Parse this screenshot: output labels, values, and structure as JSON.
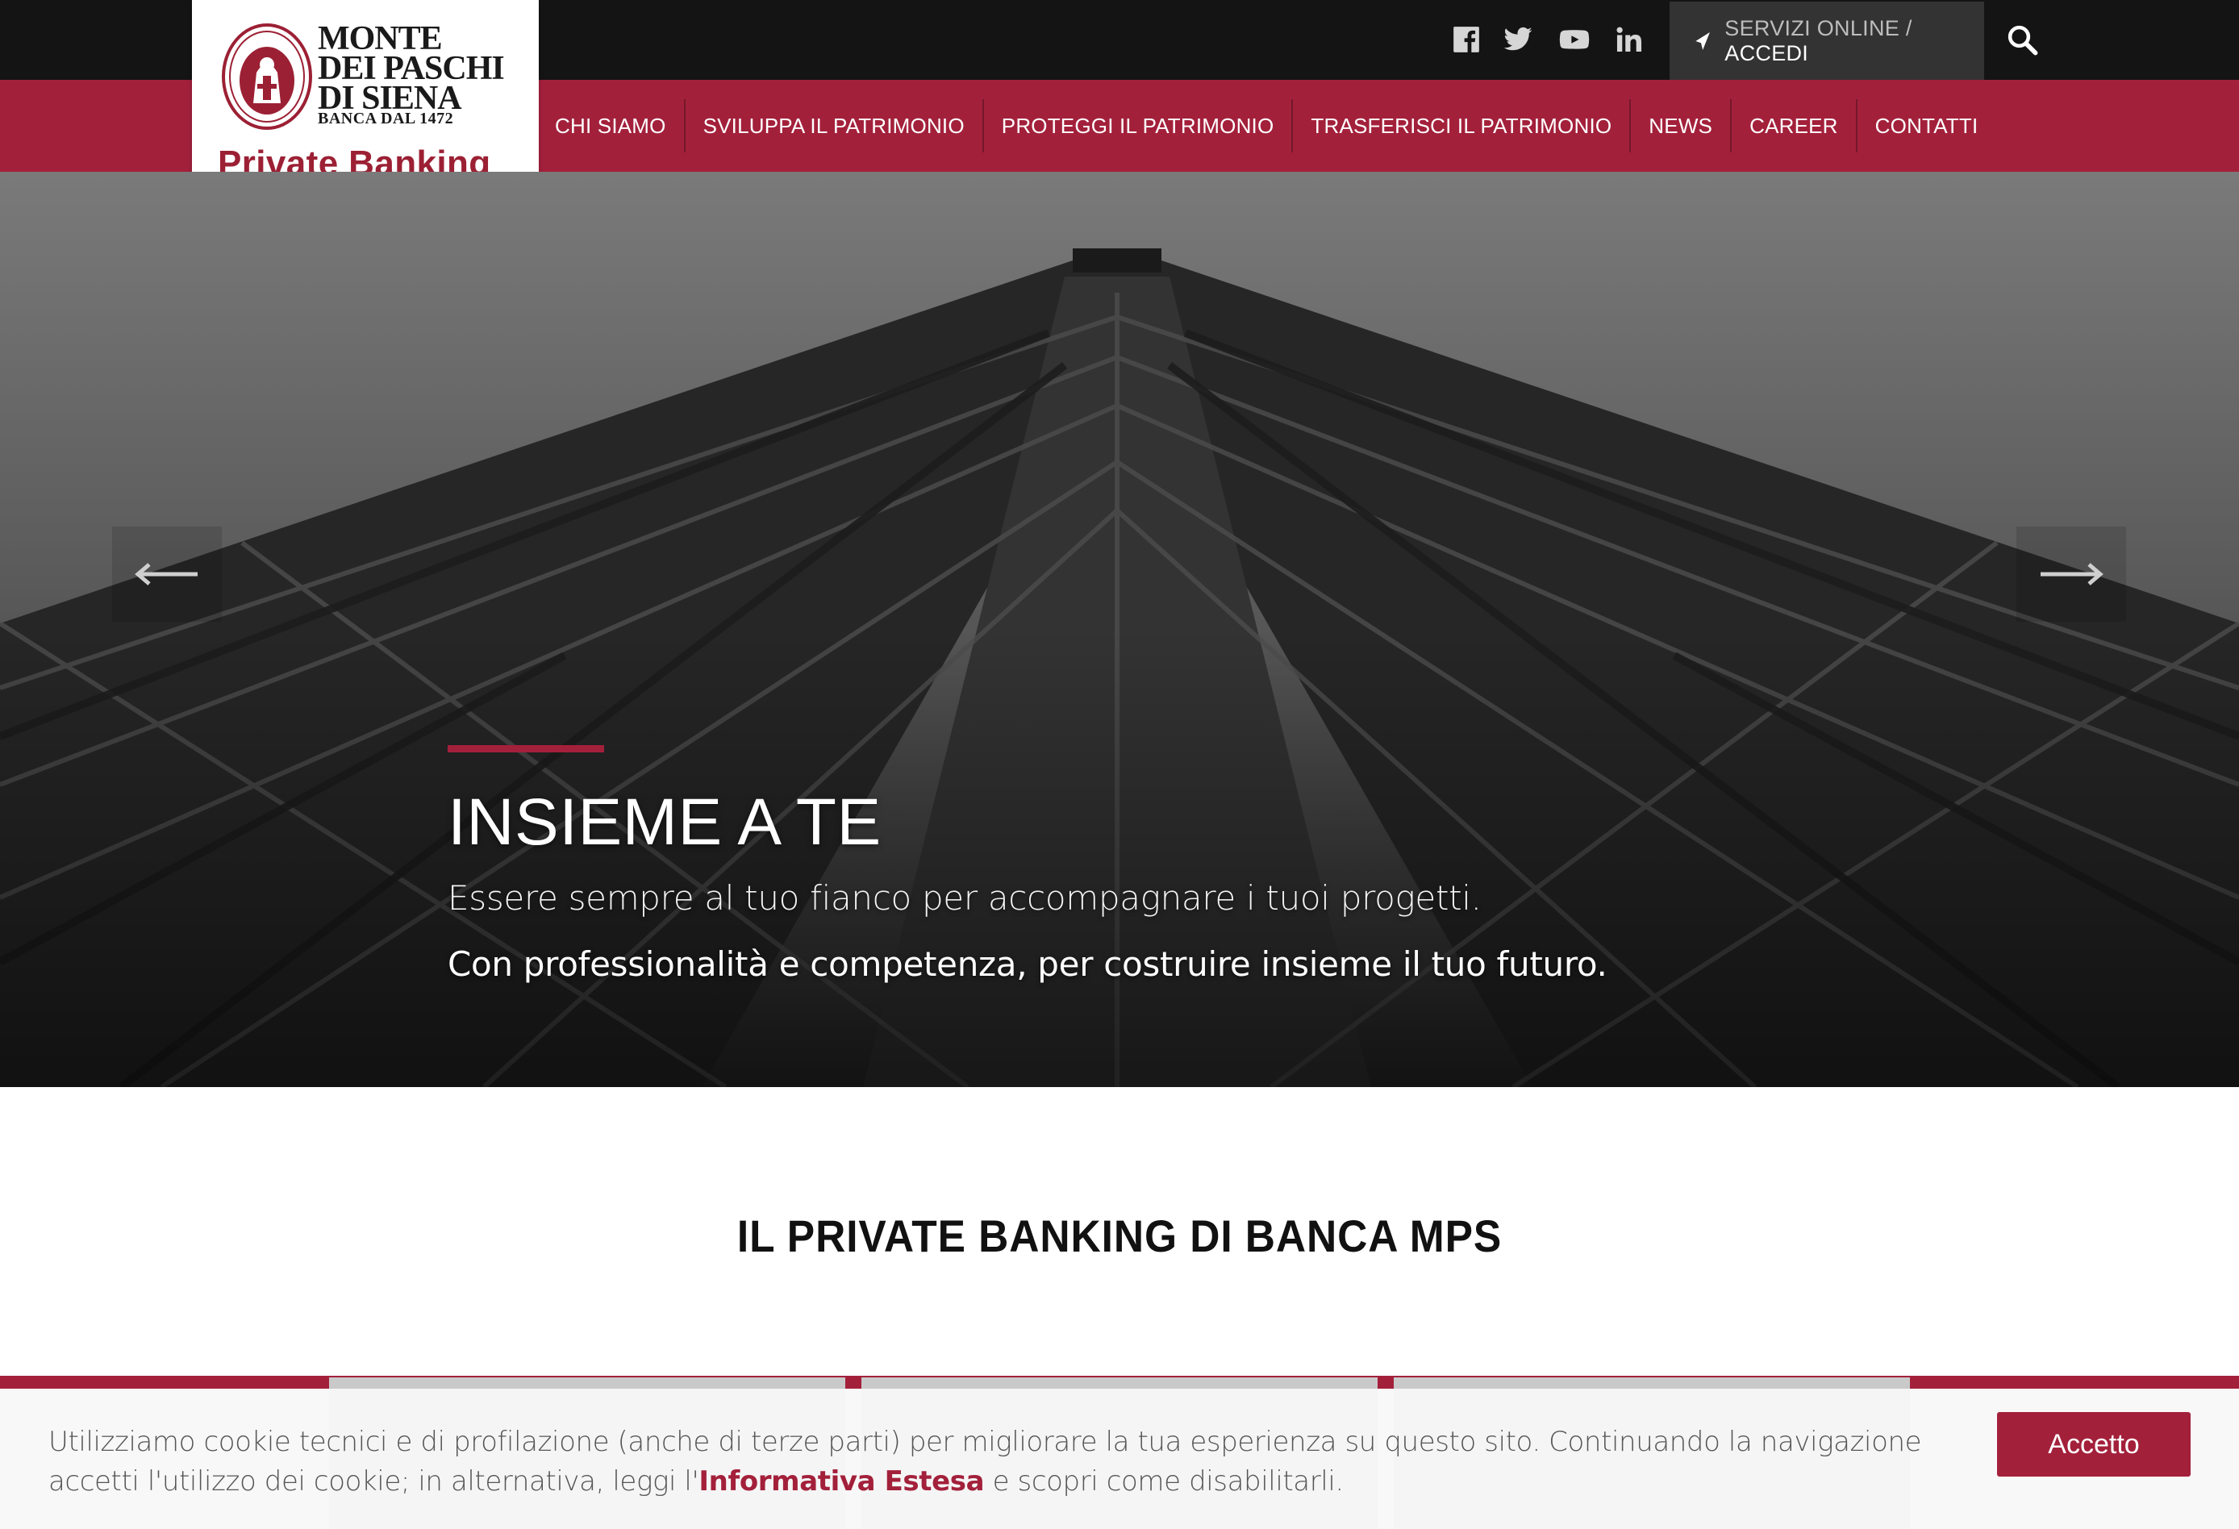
{
  "logo": {
    "name_line1": "MONTE",
    "name_line2": "DEI PASCHI",
    "name_line3": "DI SIENA",
    "since": "BANCA DAL 1472",
    "division": "Private Banking"
  },
  "topbar": {
    "social": [
      "facebook-icon",
      "twitter-icon",
      "youtube-icon",
      "linkedin-icon"
    ],
    "login_prefix": "SERVIZI ONLINE / ",
    "login_action": "ACCEDI"
  },
  "nav": {
    "items": [
      {
        "label": "CHI SIAMO"
      },
      {
        "label": "SVILUPPA IL PATRIMONIO"
      },
      {
        "label": "PROTEGGI IL PATRIMONIO"
      },
      {
        "label": "TRASFERISCI IL PATRIMONIO"
      },
      {
        "label": "NEWS"
      },
      {
        "label": "CAREER"
      },
      {
        "label": "CONTATTI"
      }
    ]
  },
  "hero": {
    "title": "INSIEME A TE",
    "subtitle1": "Essere sempre al tuo fianco per accompagnare i tuoi progetti.",
    "subtitle2": "Con professionalità e competenza, per costruire insieme il tuo futuro."
  },
  "section": {
    "title": "IL PRIVATE BANKING DI BANCA MPS"
  },
  "cookie": {
    "text_before": "Utilizziamo cookie tecnici e di profilazione (anche di terze parti) per migliorare la tua esperienza su questo sito. Continuando la navigazione accetti l'utilizzo dei cookie; in alternativa, leggi l'",
    "link": "Informativa Estesa",
    "text_after": " e scopri come disabilitarli.",
    "accept": "Accetto"
  },
  "colors": {
    "brand": "#a3203b",
    "topbar": "#141414"
  }
}
